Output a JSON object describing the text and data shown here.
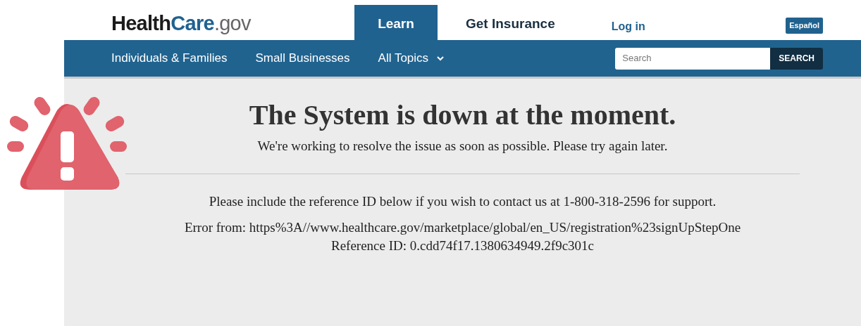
{
  "logo": [
    "Health",
    "Care",
    ".gov"
  ],
  "top_tabs": [
    {
      "label": "Learn",
      "selected": true
    },
    {
      "label": "Get Insurance",
      "selected": false
    }
  ],
  "login_link": "Log in",
  "language_button": "Español",
  "nav_items": [
    {
      "label": "Individuals & Families",
      "dropdown": false
    },
    {
      "label": "Small Businesses",
      "dropdown": false
    },
    {
      "label": "All Topics",
      "dropdown": true
    }
  ],
  "search": {
    "placeholder": "Search",
    "button": "SEARCH"
  },
  "error": {
    "title": "The System is down at the moment.",
    "subtitle": "We're working to resolve the issue as soon as possible. Please try again later.",
    "details": [
      "Please include the reference ID below if you wish to contact us at 1-800-318-2596 for support.",
      "Error from: https%3A//www.healthcare.gov/marketplace/global/en_US/registration%23signUpStepOne",
      "Reference ID: 0.cdd74f17.1380634949.2f9c301c"
    ]
  }
}
